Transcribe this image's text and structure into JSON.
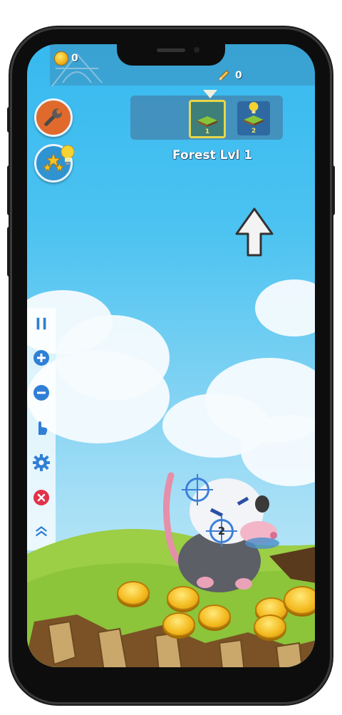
{
  "hud": {
    "coins": "0",
    "pencils": "0"
  },
  "level_panel": {
    "slots": [
      {
        "number": "1",
        "selected": true
      },
      {
        "number": "2",
        "selected": false
      }
    ],
    "title": "Forest Lvl 1"
  },
  "targets": [
    {
      "number": ""
    },
    {
      "number": "2"
    }
  ],
  "icons": {
    "coin": "coin-icon",
    "pencil": "pencil-icon",
    "wrench": "wrench-icon",
    "stars": "stars-icon",
    "hint": "lightbulb-icon",
    "pause": "pause-icon",
    "zoom_in": "plus-icon",
    "zoom_out": "minus-icon",
    "hand": "hand-icon",
    "settings": "gear-icon",
    "close": "close-icon",
    "collapse": "chevron-up-icon"
  },
  "colors": {
    "sidebar_icon": "#2f7fd6",
    "close": "#e0324a",
    "sky_top": "#37b9ef",
    "grass": "#8cc43a",
    "coin": "#f4bc22"
  }
}
